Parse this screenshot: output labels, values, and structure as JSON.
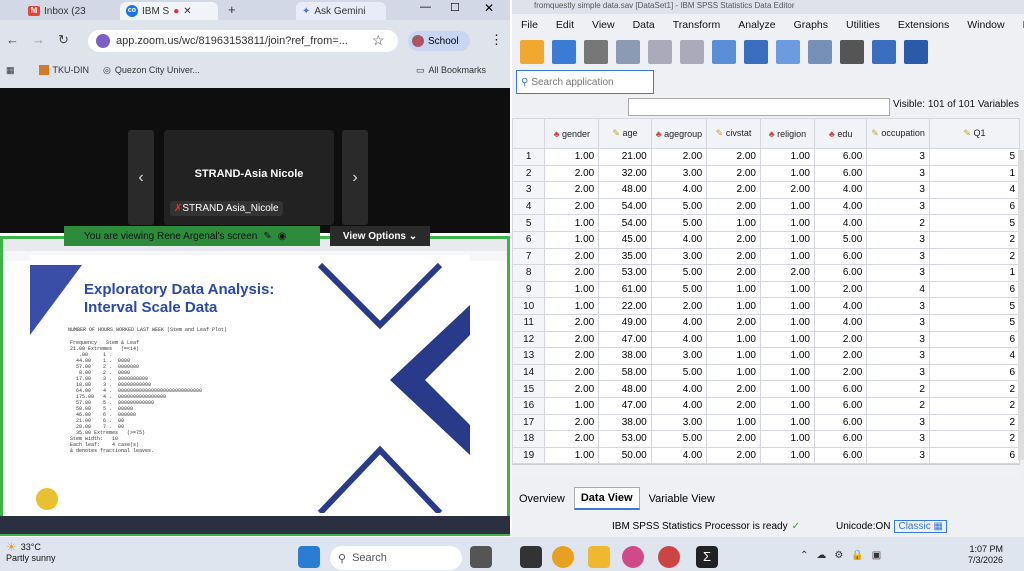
{
  "browser": {
    "tabs": [
      {
        "label": "Inbox (23"
      },
      {
        "label": "IBM S"
      },
      {
        "label": "Ask Gemini"
      }
    ],
    "url": "app.zoom.us/wc/81963153811/join?ref_from=...",
    "profile": "School",
    "bookmarks": [
      {
        "label": "TKU-DIN"
      },
      {
        "label": "Quezon City Univer..."
      },
      {
        "label": "All Bookmarks"
      }
    ]
  },
  "zoom": {
    "participant_name": "STRAND-Asia  Nicole",
    "participant_label": "STRAND Asia_Nicole",
    "banner": "You are viewing  Rene Argenal's screen",
    "view_options": "View Options"
  },
  "slide": {
    "title": "Exploratory Data Analysis: Interval Scale Data",
    "subtitle": "NUMBER OF HOURS WORKED LAST WEEK (Stem and Leaf Plot)",
    "lines": [
      "Frequency   Stem & Leaf",
      "21.00 Extremes   (=<14)",
      "   .00     1 .",
      "  44.00    1 .  0000",
      "  57.00    2 .  0000000",
      "   8.00    2 .  0000",
      "  17.00    3 .  0000000000",
      "  18.00    3 .  00000000000",
      "  64.00    4 .  0000000000000000000000000000",
      "  175.00   4 .  0000000000000000",
      "  57.00    5 .  000000000000",
      "  50.00    5 .  00000",
      "  46.00    6 .  000000",
      "  21.00    6 .  00",
      "  20.00    7 .  00",
      "  35.00 Extremes   (>=75)",
      "Stem width:   10",
      "Each leaf:    4 case(s)",
      "& denotes fractional leaves."
    ]
  },
  "spss": {
    "title": "fromquestly simple data.sav [DataSet1] - IBM SPSS Statistics Data Editor",
    "menus": [
      "File",
      "Edit",
      "View",
      "Data",
      "Transform",
      "Analyze",
      "Graphs",
      "Utilities",
      "Extensions",
      "Window",
      "He"
    ],
    "search_placeholder": "Search application",
    "visible": "Visible: 101 of 101 Variables",
    "columns": [
      "gender",
      "age",
      "agegroup",
      "civstat",
      "religion",
      "edu",
      "occupation",
      "Q1"
    ],
    "rows": [
      [
        "1",
        "1.00",
        "21.00",
        "2.00",
        "2.00",
        "1.00",
        "6.00",
        "3",
        "5"
      ],
      [
        "2",
        "2.00",
        "32.00",
        "3.00",
        "2.00",
        "1.00",
        "6.00",
        "3",
        "1"
      ],
      [
        "3",
        "2.00",
        "48.00",
        "4.00",
        "2.00",
        "2.00",
        "4.00",
        "3",
        "4"
      ],
      [
        "4",
        "2.00",
        "54.00",
        "5.00",
        "2.00",
        "1.00",
        "4.00",
        "3",
        "6"
      ],
      [
        "5",
        "1.00",
        "54.00",
        "5.00",
        "1.00",
        "1.00",
        "4.00",
        "2",
        "5"
      ],
      [
        "6",
        "1.00",
        "45.00",
        "4.00",
        "2.00",
        "1.00",
        "5.00",
        "3",
        "2"
      ],
      [
        "7",
        "2.00",
        "35.00",
        "3.00",
        "2.00",
        "1.00",
        "6.00",
        "3",
        "2"
      ],
      [
        "8",
        "2.00",
        "53.00",
        "5.00",
        "2.00",
        "2.00",
        "6.00",
        "3",
        "1"
      ],
      [
        "9",
        "1.00",
        "61.00",
        "5.00",
        "1.00",
        "1.00",
        "2.00",
        "4",
        "6"
      ],
      [
        "10",
        "1.00",
        "22.00",
        "2.00",
        "1.00",
        "1.00",
        "4.00",
        "3",
        "5"
      ],
      [
        "11",
        "2.00",
        "49.00",
        "4.00",
        "2.00",
        "1.00",
        "4.00",
        "3",
        "5"
      ],
      [
        "12",
        "2.00",
        "47.00",
        "4.00",
        "1.00",
        "1.00",
        "2.00",
        "3",
        "6"
      ],
      [
        "13",
        "2.00",
        "38.00",
        "3.00",
        "1.00",
        "1.00",
        "2.00",
        "3",
        "4"
      ],
      [
        "14",
        "2.00",
        "58.00",
        "5.00",
        "1.00",
        "1.00",
        "2.00",
        "3",
        "6"
      ],
      [
        "15",
        "2.00",
        "48.00",
        "4.00",
        "2.00",
        "1.00",
        "6.00",
        "2",
        "2"
      ],
      [
        "16",
        "1.00",
        "47.00",
        "4.00",
        "2.00",
        "1.00",
        "6.00",
        "2",
        "2"
      ],
      [
        "17",
        "2.00",
        "38.00",
        "3.00",
        "1.00",
        "1.00",
        "6.00",
        "3",
        "2"
      ],
      [
        "18",
        "2.00",
        "53.00",
        "5.00",
        "2.00",
        "1.00",
        "6.00",
        "3",
        "2"
      ],
      [
        "19",
        "1.00",
        "50.00",
        "4.00",
        "2.00",
        "1.00",
        "6.00",
        "3",
        "6"
      ]
    ],
    "tabs": [
      "Overview",
      "Data View",
      "Variable View"
    ],
    "status_processor": "IBM SPSS Statistics Processor is ready",
    "status_unicode": "Unicode:ON",
    "status_classic": "Classic"
  },
  "taskbar": {
    "temp": "33°C",
    "weather": "Partly sunny",
    "search": "Search",
    "time": "1:07 PM",
    "date": "7/3/2026"
  }
}
